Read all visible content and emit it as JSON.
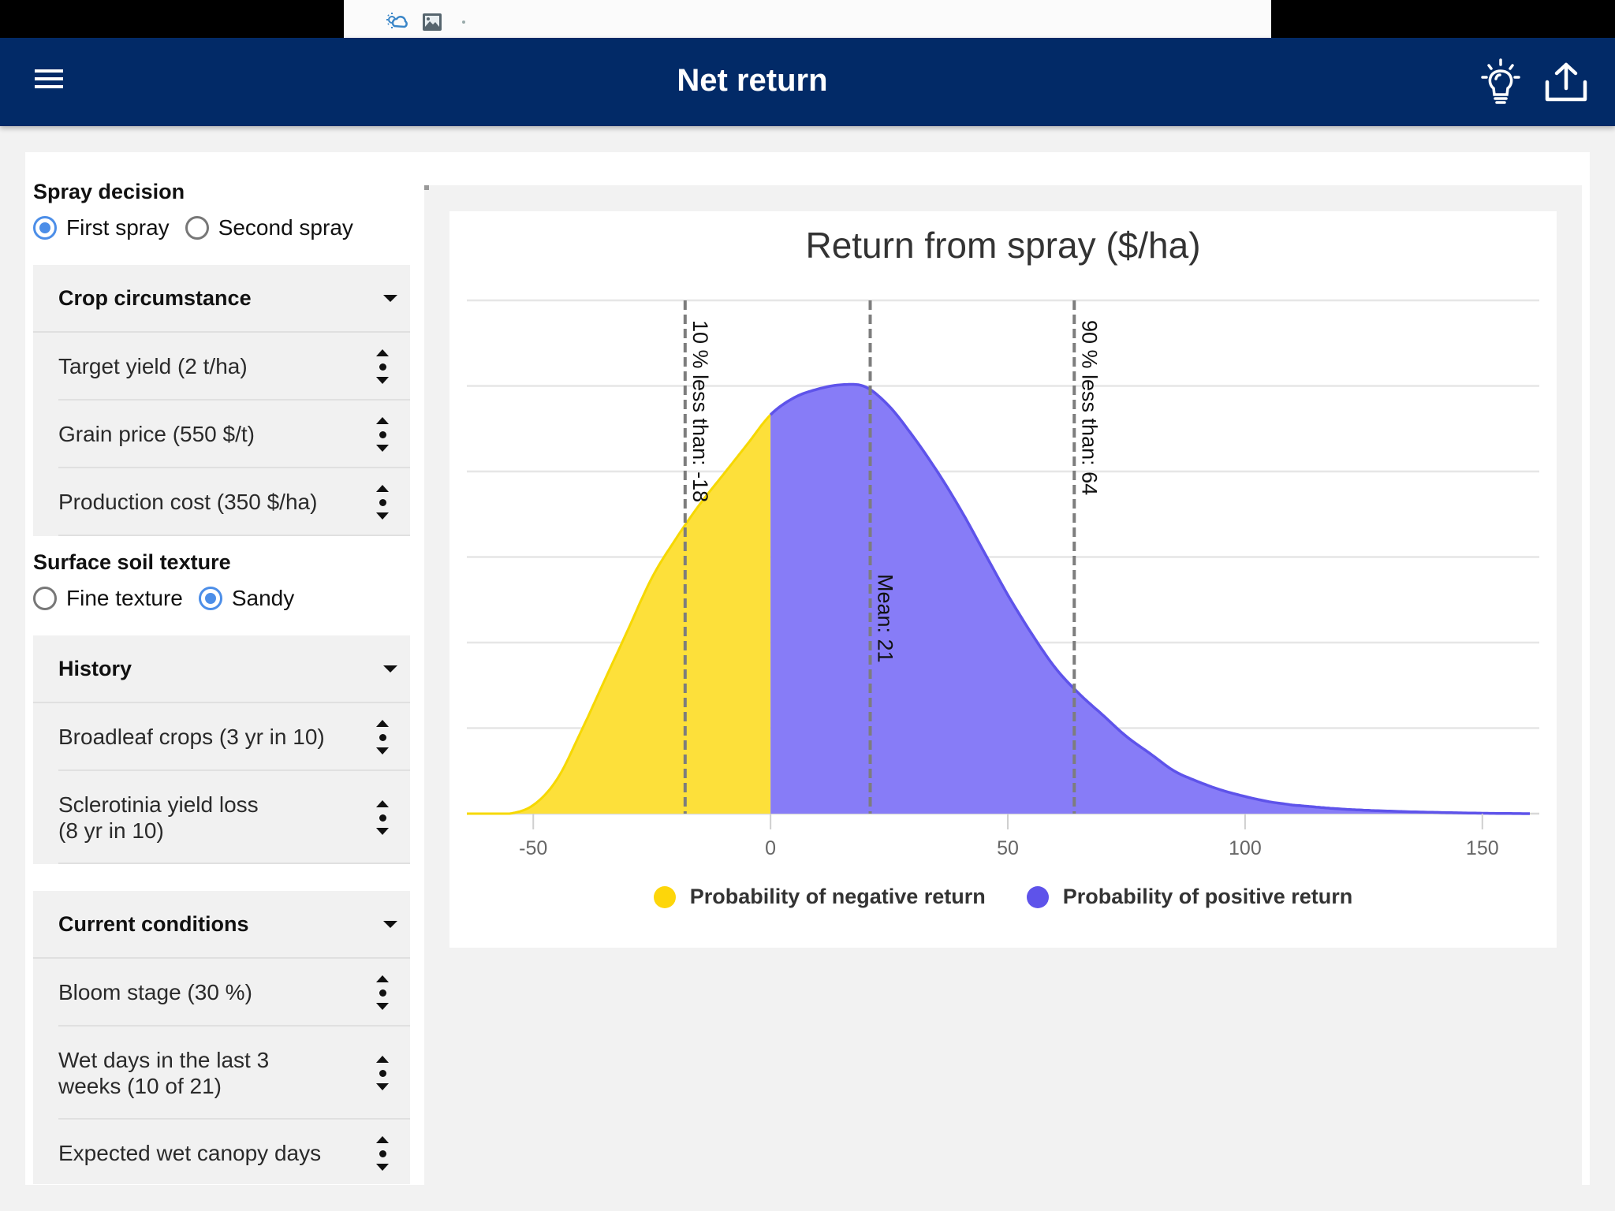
{
  "browser": {
    "icons": [
      "weather-cloud-icon",
      "image-icon"
    ]
  },
  "appbar": {
    "title": "Net return",
    "icons": {
      "menu": "hamburger-menu-icon",
      "tips": "lightbulb-icon",
      "share": "share-upload-icon"
    }
  },
  "sidebar": {
    "spray_decision": {
      "label": "Spray decision",
      "options": [
        {
          "label": "First spray",
          "checked": true
        },
        {
          "label": "Second spray",
          "checked": false
        }
      ]
    },
    "crop_circumstance": {
      "label": "Crop circumstance",
      "items": [
        "Target yield (2 t/ha)",
        "Grain price (550 $/t)",
        "Production cost (350 $/ha)"
      ]
    },
    "soil_texture": {
      "label": "Surface soil texture",
      "options": [
        {
          "label": "Fine texture",
          "checked": false
        },
        {
          "label": "Sandy",
          "checked": true
        }
      ]
    },
    "history": {
      "label": "History",
      "items": [
        "Broadleaf crops (3 yr in 10)",
        "Sclerotinia yield loss\n(8 yr in 10)"
      ]
    },
    "current_conditions": {
      "label": "Current conditions",
      "items": [
        "Bloom stage (30 %)",
        "Wet days in the last 3 weeks (10 of 21)",
        "Expected wet canopy days"
      ]
    }
  },
  "colors": {
    "negative": "#fde03a",
    "negative_legend": "#fdd60a",
    "positive": "#877cf7",
    "positive_line": "#5e53ea",
    "positive_legend": "#5e53ea",
    "appbar": "#022a67",
    "radio_checked": "#4c8ee8"
  },
  "chart_data": {
    "type": "area",
    "title": "Return from spray ($/ha)",
    "xlabel": "",
    "ylabel": "",
    "xlim": [
      -64,
      162
    ],
    "ylim": [
      0,
      1
    ],
    "x_ticks": [
      -50,
      0,
      50,
      100,
      150
    ],
    "grid": true,
    "y_gridlines": 6,
    "legend_position": "bottom",
    "series": [
      {
        "name": "Probability of negative return",
        "color": "#fde03a",
        "range": [
          -64,
          0
        ]
      },
      {
        "name": "Probability of positive return",
        "color": "#877cf7",
        "range": [
          0,
          160
        ]
      }
    ],
    "density": {
      "x": [
        -64,
        -55,
        -50,
        -45,
        -40,
        -35,
        -30,
        -25,
        -20,
        -15,
        -10,
        -5,
        0,
        5,
        10,
        15,
        20,
        25,
        30,
        35,
        40,
        45,
        50,
        55,
        60,
        65,
        70,
        75,
        80,
        85,
        90,
        95,
        100,
        105,
        110,
        120,
        130,
        140,
        150,
        160
      ],
      "y": [
        0.0,
        0.0,
        0.02,
        0.08,
        0.19,
        0.31,
        0.43,
        0.55,
        0.64,
        0.72,
        0.79,
        0.86,
        0.93,
        0.97,
        0.99,
        1.0,
        0.995,
        0.95,
        0.88,
        0.8,
        0.71,
        0.61,
        0.51,
        0.42,
        0.34,
        0.28,
        0.23,
        0.18,
        0.14,
        0.1,
        0.075,
        0.055,
        0.04,
        0.028,
        0.02,
        0.011,
        0.006,
        0.003,
        0.001,
        0.0
      ]
    },
    "reference_lines": [
      {
        "x": -18,
        "label": "10 % less than: -18"
      },
      {
        "x": 21,
        "label": "Mean: 21"
      },
      {
        "x": 64,
        "label": "90 % less than: 64"
      }
    ]
  }
}
